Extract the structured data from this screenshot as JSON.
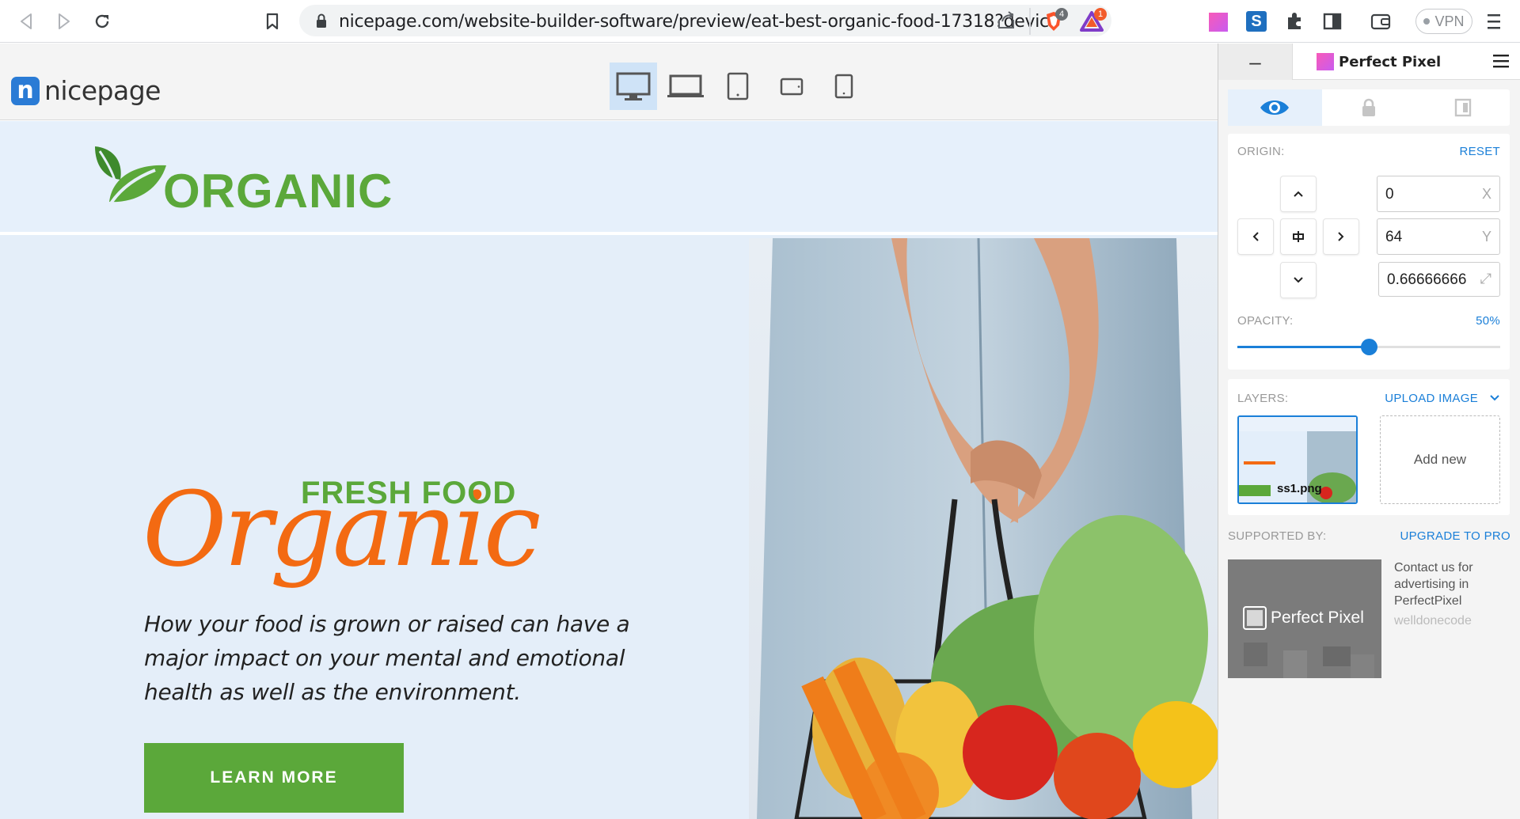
{
  "browser": {
    "url": "nicepage.com/website-builder-software/preview/eat-best-organic-food-17318?device...",
    "brave_badge": "4",
    "rewards_badge": "1",
    "vpn_label": "VPN"
  },
  "nicepage": {
    "logo_text": "nicepage",
    "devices": [
      "desktop",
      "laptop",
      "tablet",
      "tablet-landscape",
      "phone"
    ],
    "selected_device": "desktop"
  },
  "site": {
    "logo_text": "ORGANIC",
    "fresh_food": "FRESH FOOD",
    "organic_script": "Organic",
    "description": "How your food is grown or raised can have a major impact on your mental and emotional health as well as the environment.",
    "button": "LEARN MORE"
  },
  "perfect_pixel": {
    "minimize_label": "–",
    "title": "Perfect Pixel",
    "origin_label": "ORIGIN:",
    "reset_label": "RESET",
    "x_value": "0",
    "x_unit": "X",
    "y_value": "64",
    "y_unit": "Y",
    "scale_value": "0.66666666",
    "opacity_label": "OPACITY:",
    "opacity_value": "50%",
    "opacity_fraction": 0.5,
    "layers_label": "LAYERS:",
    "upload_label": "UPLOAD IMAGE",
    "layer_name": "ss1.png",
    "add_new_label": "Add new",
    "supported_label": "SUPPORTED BY:",
    "upgrade_label": "UPGRADE TO PRO",
    "ad_logo_text": "Perfect Pixel",
    "ad_text": "Contact us for advertising in PerfectPixel",
    "ad_author": "welldonecode"
  },
  "colors": {
    "accent_blue": "#1a7fd8",
    "green": "#5ba83a",
    "orange": "#f36a12"
  }
}
